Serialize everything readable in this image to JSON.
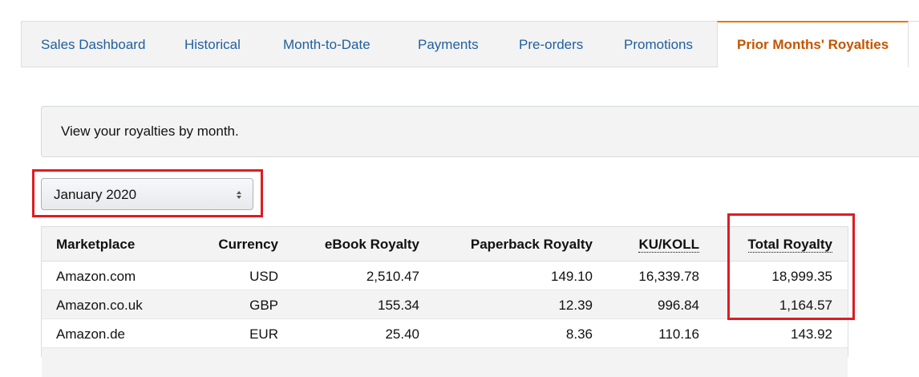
{
  "tabs": [
    {
      "label": "Sales Dashboard"
    },
    {
      "label": "Historical"
    },
    {
      "label": "Month-to-Date"
    },
    {
      "label": "Payments"
    },
    {
      "label": "Pre-orders"
    },
    {
      "label": "Promotions"
    },
    {
      "label": "Prior Months' Royalties",
      "active": true
    }
  ],
  "info": {
    "text": "View your royalties by month."
  },
  "month_select": {
    "value": "January 2020"
  },
  "table": {
    "headers": {
      "marketplace": "Marketplace",
      "currency": "Currency",
      "ebook": "eBook Royalty",
      "paperback": "Paperback Royalty",
      "ku": "KU/KOLL",
      "total": "Total Royalty"
    },
    "rows": [
      {
        "marketplace": "Amazon.com",
        "currency": "USD",
        "ebook": "2,510.47",
        "paperback": "149.10",
        "ku": "16,339.78",
        "total": "18,999.35"
      },
      {
        "marketplace": "Amazon.co.uk",
        "currency": "GBP",
        "ebook": "155.34",
        "paperback": "12.39",
        "ku": "996.84",
        "total": "1,164.57"
      },
      {
        "marketplace": "Amazon.de",
        "currency": "EUR",
        "ebook": "25.40",
        "paperback": "8.36",
        "ku": "110.16",
        "total": "143.92"
      }
    ]
  },
  "colors": {
    "tab_link": "#1f5f9f",
    "tab_active": "#c45500",
    "highlight": "#e01b22"
  }
}
